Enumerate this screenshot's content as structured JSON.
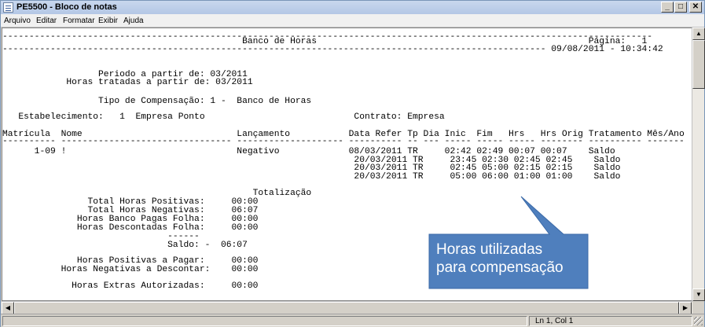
{
  "window": {
    "title": "PE5500 - Bloco de notas",
    "buttons": {
      "minimize": "_",
      "maximize": "□",
      "close": "✕"
    }
  },
  "menu": {
    "items": [
      "Arquivo",
      "Editar",
      "Formatar",
      "Exibir",
      "Ajuda"
    ]
  },
  "document": {
    "lines": [
      "--------------------------------------------------------------------------------------------------------------------------",
      "                                             Banco de Horas                                                   Página:   1",
      "------------------------------------------------------------------------------------------------------ 09/08/2011 - 10:34:42",
      "",
      "",
      "                  Periodo a partir de: 03/2011",
      "            Horas tratadas a partir de: 03/2011",
      "",
      "                  Tipo de Compensação: 1 -  Banco de Horas",
      "",
      "   Estabelecimento:   1  Empresa Ponto                            Contrato: Empresa",
      "",
      "Matrícula  Nome                             Lançamento           Data Refer Tp Dia Inic  Fim   Hrs   Hrs Orig Tratamento Mês/Ano",
      "---------- -------------------------------- -------------------- ---------- -- --- ----- ----- ----- -------- ---------- -------",
      "      1-09 !                                Negativo             08/03/2011 TR     02:42 02:49 00:07 00:07    Saldo",
      "                                                                  20/03/2011 TR     23:45 02:30 02:45 02:45    Saldo",
      "                                                                  20/03/2011 TR     02:45 05:00 02:15 02:15    Saldo",
      "                                                                  20/03/2011 TR     05:00 06:00 01:00 01:00    Saldo",
      "",
      "                                               Totalização",
      "                Total Horas Positivas:     00:00",
      "                Total Horas Negativas:     06:07",
      "              Horas Banco Pagas Folha:     00:00",
      "              Horas Descontadas Folha:     00:00",
      "                               ------",
      "                               Saldo: -  06:07",
      "",
      "              Horas Positivas a Pagar:     00:00",
      "           Horas Negativas a Descontar:    00:00",
      "",
      "             Horas Extras Autorizadas:     00:00"
    ]
  },
  "status": {
    "position": "Ln 1, Col 1"
  },
  "callout": {
    "text": "Horas utilizadas\npara compensação",
    "fill": "#4f7fbd"
  }
}
